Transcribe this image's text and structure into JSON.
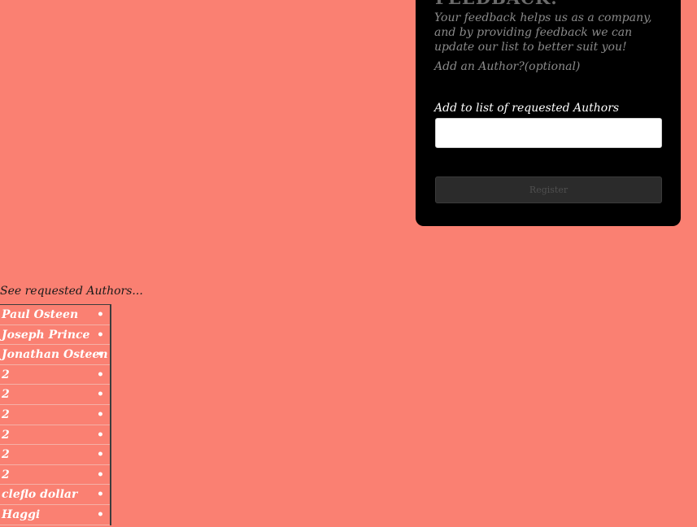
{
  "feedback": {
    "title": "FEEDBACK:",
    "description": "Your feedback helps us as a company, and by providing feedback we can update our list to better suit you!",
    "optional_label": "Add an Author?(optional)",
    "author_label": "Add to list of requested Authors",
    "author_input_value": "",
    "register_label": "Register"
  },
  "requested": {
    "label": "See requested Authors...",
    "bullet": "•",
    "authors": [
      "Paul Osteen",
      "Joseph Prince",
      "Jonathan Osteen",
      "2",
      "2",
      "2",
      "2",
      "2",
      "2",
      "cleflo dollar",
      "Haggi"
    ]
  },
  "colors": {
    "background": "#FA8072",
    "panel": "#000000",
    "button": "#2b2b2b"
  }
}
